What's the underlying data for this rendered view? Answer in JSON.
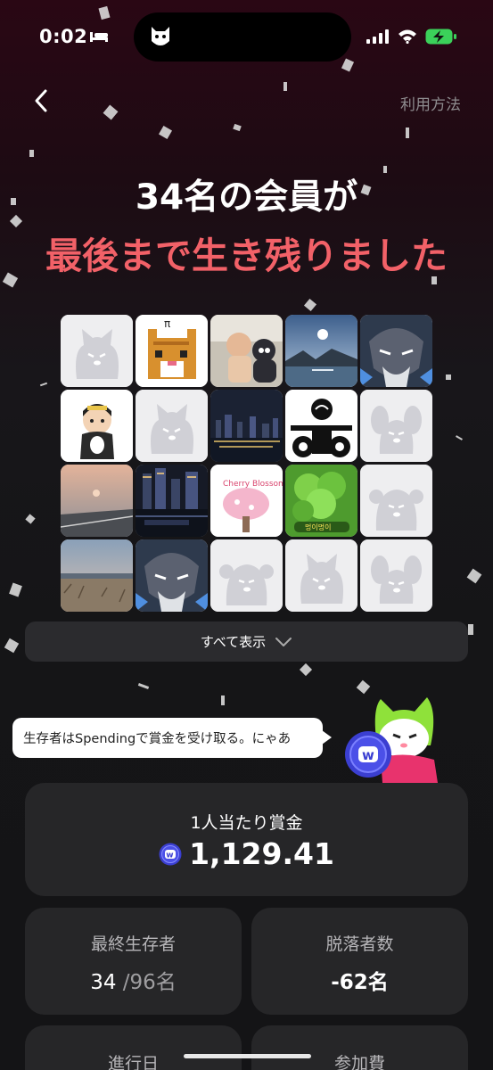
{
  "status_bar": {
    "time": "0:02"
  },
  "header": {
    "help_link": "利用方法"
  },
  "title": {
    "line1": "34名の会員が",
    "line2": "最後まで生き残りました"
  },
  "colors": {
    "accent_red": "#f26168",
    "card_bg": "#262628",
    "coin_blue": "#3b3fd1",
    "mascot_green": "#8fe13a"
  },
  "avatars": [
    {
      "kind": "placeholder-cat"
    },
    {
      "kind": "pixel-cat",
      "text": "π"
    },
    {
      "kind": "photo-baby"
    },
    {
      "kind": "photo-lake"
    },
    {
      "kind": "warrior-art"
    },
    {
      "kind": "cartoon-kid"
    },
    {
      "kind": "placeholder-cat"
    },
    {
      "kind": "photo-city-night"
    },
    {
      "kind": "motorcycle-art"
    },
    {
      "kind": "placeholder-dog"
    },
    {
      "kind": "photo-sunset-road"
    },
    {
      "kind": "photo-river-night"
    },
    {
      "kind": "cherry-blossom",
      "text": "Cherry Blossom"
    },
    {
      "kind": "clover",
      "text": "멍이멍이"
    },
    {
      "kind": "placeholder-bear"
    },
    {
      "kind": "photo-field"
    },
    {
      "kind": "warrior-art"
    },
    {
      "kind": "placeholder-bear"
    },
    {
      "kind": "placeholder-cat"
    },
    {
      "kind": "placeholder-dog"
    }
  ],
  "show_all": {
    "label": "すべて表示",
    "icon": "chevron-down-icon"
  },
  "speech_bubble": {
    "text": "生存者はSpendingで賞金を受け取る。にゃあ"
  },
  "prize": {
    "label": "1人当たり賞金",
    "value": "1,129.41",
    "icon": "w-coin-icon"
  },
  "stats": {
    "survivors_label": "最終生存者",
    "survivors_value": "34",
    "survivors_total": "/96名",
    "dropouts_label": "脱落者数",
    "dropouts_value": "-62名",
    "days_label": "進行日",
    "fee_label": "参加費"
  }
}
